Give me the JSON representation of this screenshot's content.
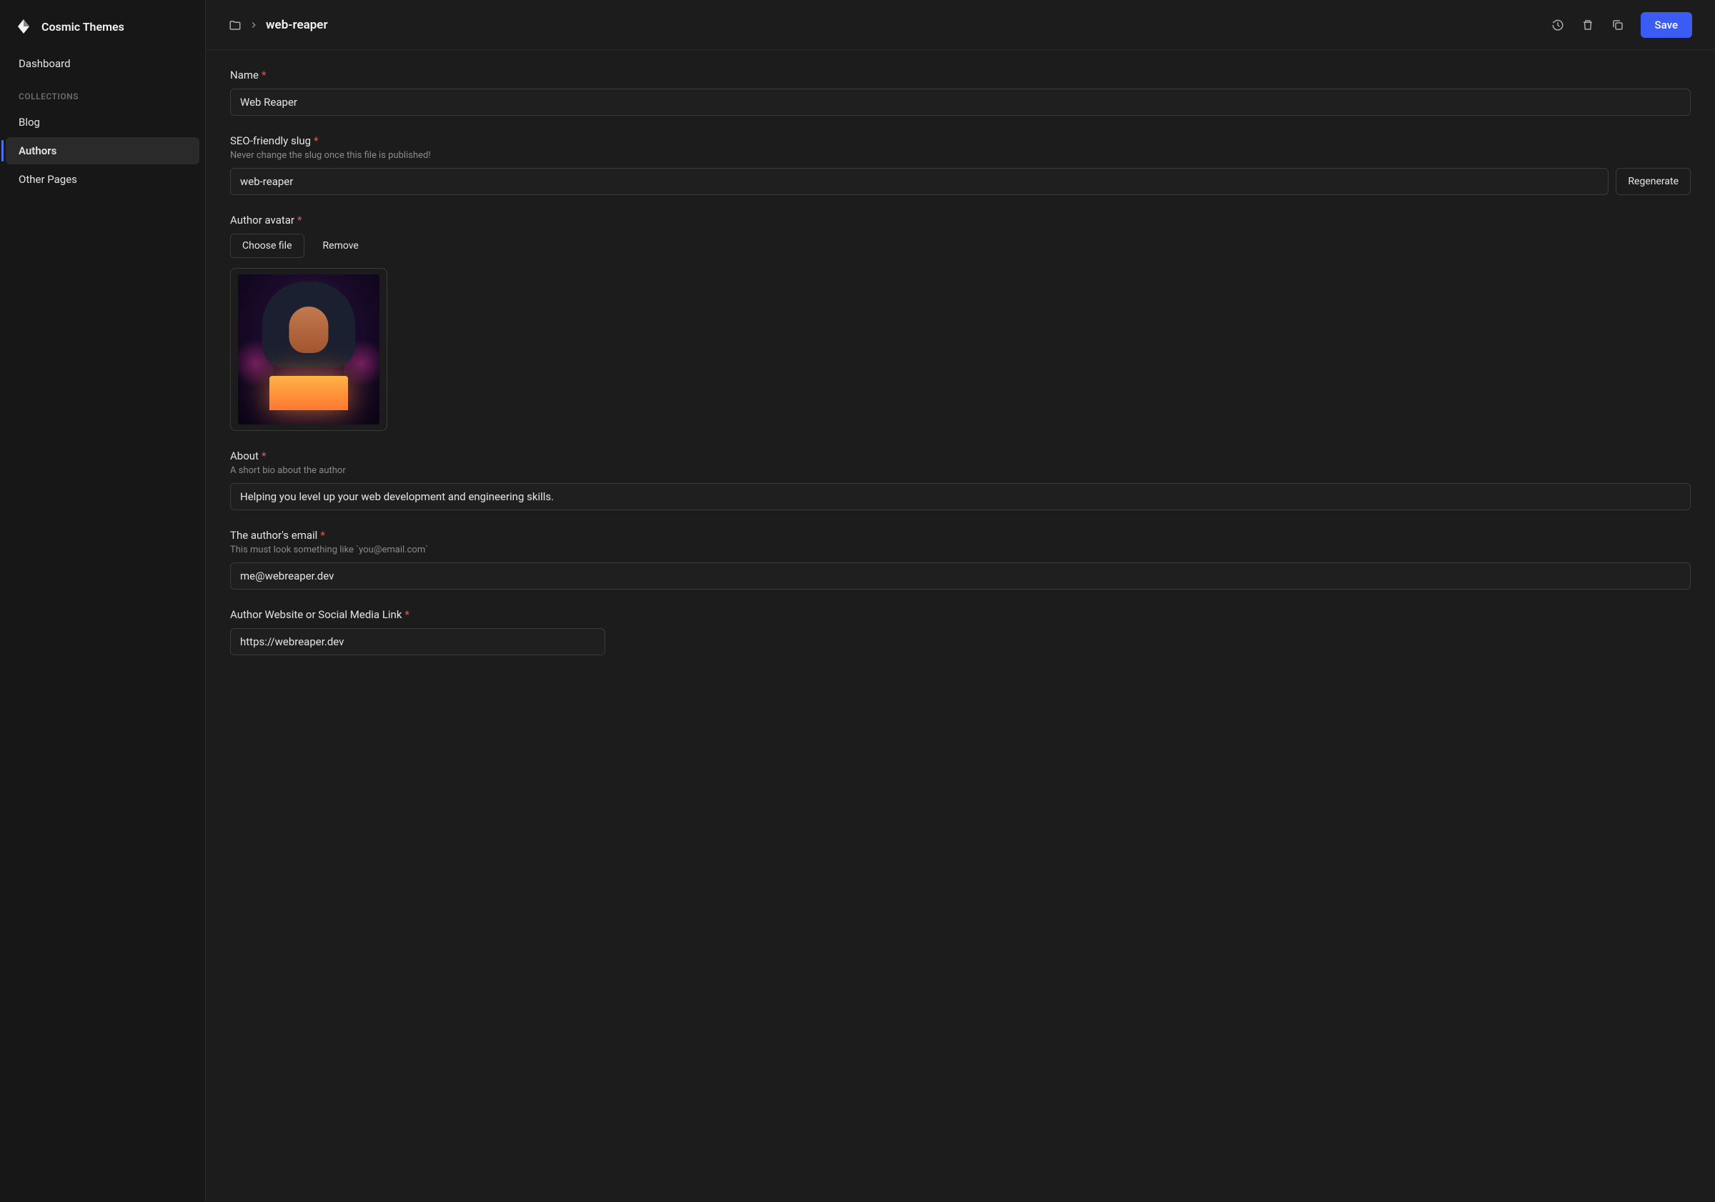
{
  "brand": {
    "title": "Cosmic Themes"
  },
  "sidebar": {
    "dashboard": "Dashboard",
    "sectionLabel": "COLLECTIONS",
    "items": [
      {
        "label": "Blog",
        "active": false
      },
      {
        "label": "Authors",
        "active": true
      },
      {
        "label": "Other Pages",
        "active": false
      }
    ]
  },
  "topbar": {
    "currentFile": "web-reaper",
    "saveLabel": "Save"
  },
  "fields": {
    "name": {
      "label": "Name",
      "value": "Web Reaper"
    },
    "slug": {
      "label": "SEO-friendly slug",
      "help": "Never change the slug once this file is published!",
      "value": "web-reaper",
      "regenerateLabel": "Regenerate"
    },
    "avatar": {
      "label": "Author avatar",
      "chooseLabel": "Choose file",
      "removeLabel": "Remove"
    },
    "about": {
      "label": "About",
      "help": "A short bio about the author",
      "value": "Helping you level up your web development and engineering skills."
    },
    "email": {
      "label": "The author's email",
      "help": "This must look something like `you@email.com`",
      "value": "me@webreaper.dev"
    },
    "website": {
      "label": "Author Website or Social Media Link",
      "value": "https://webreaper.dev"
    }
  }
}
